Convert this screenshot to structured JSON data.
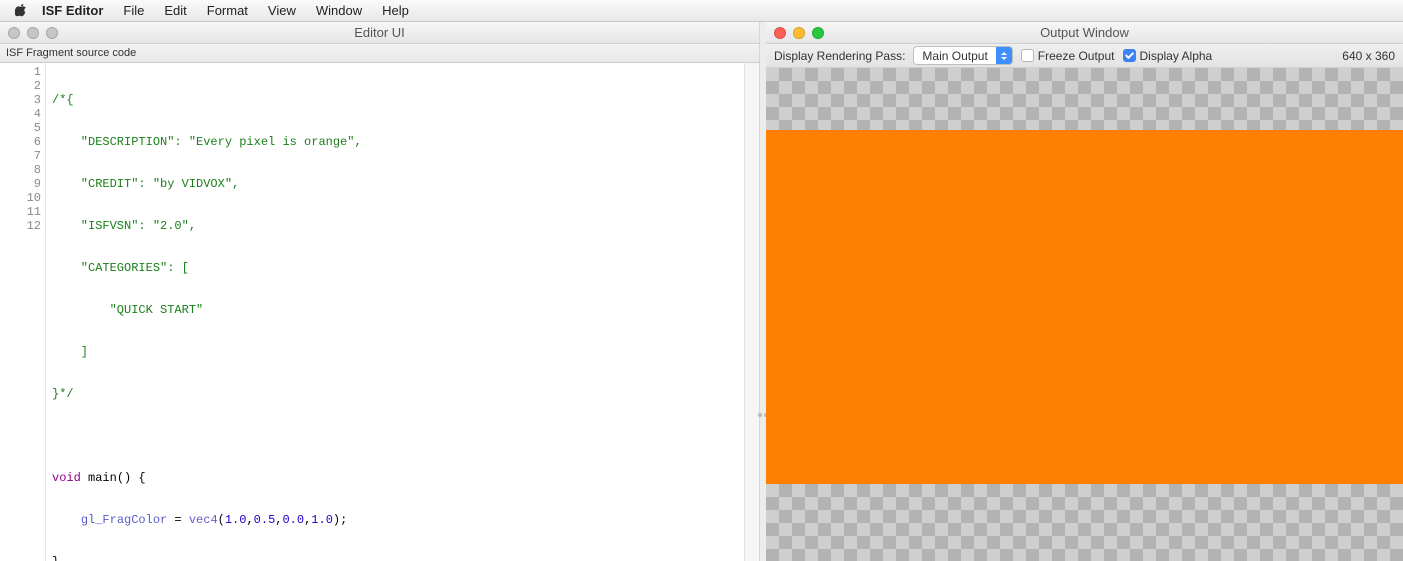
{
  "menubar": {
    "app_name": "ISF Editor",
    "items": [
      "File",
      "Edit",
      "Format",
      "View",
      "Window",
      "Help"
    ]
  },
  "editor_window": {
    "title": "Editor UI",
    "subheader": "ISF Fragment source code",
    "line_count": 12,
    "code_lines": {
      "l1": "/*{",
      "l2": "    \"DESCRIPTION\": \"Every pixel is orange\",",
      "l3": "    \"CREDIT\": \"by VIDVOX\",",
      "l4": "    \"ISFVSN\": \"2.0\",",
      "l5": "    \"CATEGORIES\": [",
      "l6": "        \"QUICK START\"",
      "l7": "    ]",
      "l8": "}*/",
      "l9": "",
      "l10_kw": "void",
      "l10_rest": " main() {",
      "l11_indent": "    ",
      "l11_ident": "gl_FragColor",
      "l11_eq": " = ",
      "l11_type": "vec4",
      "l11_open": "(",
      "l11_n1": "1.0",
      "l11_c1": ",",
      "l11_n2": "0.5",
      "l11_c2": ",",
      "l11_n3": "0.0",
      "l11_c3": ",",
      "l11_n4": "1.0",
      "l11_close": ");",
      "l12": "}"
    }
  },
  "output_window": {
    "title": "Output Window",
    "toolbar": {
      "pass_label": "Display Rendering Pass:",
      "pass_value": "Main Output",
      "freeze_label": "Freeze Output",
      "freeze_checked": false,
      "alpha_label": "Display Alpha",
      "alpha_checked": true,
      "resolution": "640 x 360"
    },
    "render_color": "#ff8000"
  }
}
